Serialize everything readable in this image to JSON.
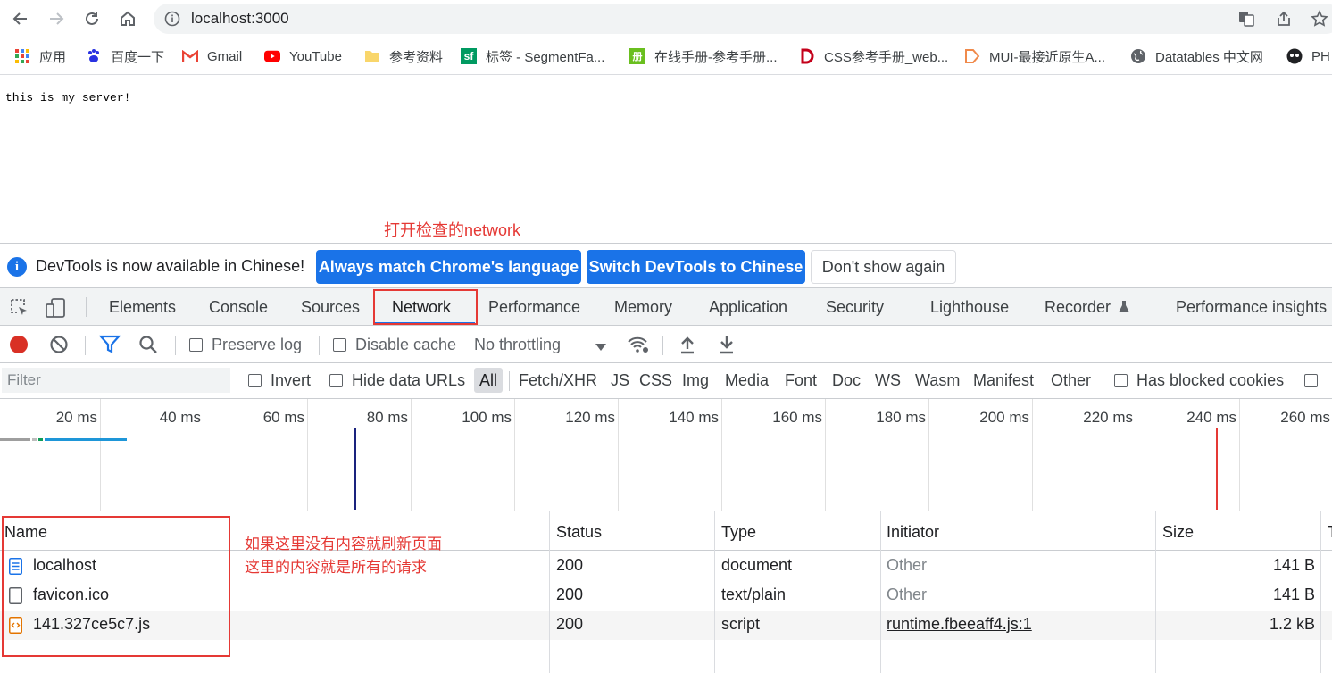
{
  "browser": {
    "url": "localhost:3000",
    "bookmarks": [
      {
        "label": "应用",
        "icon": "apps-grid-icon"
      },
      {
        "label": "百度一下",
        "icon": "baidu-paw-icon"
      },
      {
        "label": "Gmail",
        "icon": "gmail-icon"
      },
      {
        "label": "YouTube",
        "icon": "youtube-icon"
      },
      {
        "label": "参考资料",
        "icon": "folder-icon"
      },
      {
        "label": "标签 - SegmentFa...",
        "icon": "segmentfault-icon"
      },
      {
        "label": "在线手册-参考手册...",
        "icon": "manual-icon"
      },
      {
        "label": "CSS参考手册_web...",
        "icon": "css-manual-icon"
      },
      {
        "label": "MUI-最接近原生A...",
        "icon": "mui-icon"
      },
      {
        "label": "Datatables 中文网",
        "icon": "globe-icon"
      },
      {
        "label": "PH",
        "icon": "ph-icon"
      }
    ]
  },
  "page": {
    "body_text": "this is my server!"
  },
  "annotations": {
    "open_network": "打开检查的network",
    "hint_line1": "如果这里没有内容就刷新页面",
    "hint_line2": "这里的内容就是所有的请求"
  },
  "devtools": {
    "infobar": {
      "message": "DevTools is now available in Chinese!",
      "btn_match": "Always match Chrome's language",
      "btn_switch": "Switch DevTools to Chinese",
      "btn_dismiss": "Don't show again"
    },
    "tabs": [
      "Elements",
      "Console",
      "Sources",
      "Network",
      "Performance",
      "Memory",
      "Application",
      "Security",
      "Lighthouse",
      "Recorder",
      "Performance insights"
    ],
    "active_tab": "Network",
    "toolbar": {
      "preserve_log": "Preserve log",
      "disable_cache": "Disable cache",
      "throttling": "No throttling"
    },
    "filter": {
      "placeholder": "Filter",
      "invert": "Invert",
      "hide_data_urls": "Hide data URLs",
      "types": [
        "All",
        "Fetch/XHR",
        "JS",
        "CSS",
        "Img",
        "Media",
        "Font",
        "Doc",
        "WS",
        "Wasm",
        "Manifest",
        "Other"
      ],
      "has_blocked_cookies": "Has blocked cookies"
    },
    "overview": {
      "ticks": [
        "20 ms",
        "40 ms",
        "60 ms",
        "80 ms",
        "100 ms",
        "120 ms",
        "140 ms",
        "160 ms",
        "180 ms",
        "200 ms",
        "220 ms",
        "240 ms",
        "260 ms"
      ],
      "dom_content_loaded_color": "#1a237e",
      "load_color": "#e53935"
    },
    "table": {
      "columns": [
        "Name",
        "Status",
        "Type",
        "Initiator",
        "Size"
      ],
      "rows": [
        {
          "name": "localhost",
          "status": "200",
          "type": "document",
          "initiator": "Other",
          "size": "141 B",
          "icon": "document-file-icon"
        },
        {
          "name": "favicon.ico",
          "status": "200",
          "type": "text/plain",
          "initiator": "Other",
          "size": "141 B",
          "icon": "generic-file-icon"
        },
        {
          "name": "141.327ce5c7.js",
          "status": "200",
          "type": "script",
          "initiator": "runtime.fbeeaff4.js:1",
          "size": "1.2 kB",
          "icon": "script-file-icon"
        }
      ]
    }
  }
}
